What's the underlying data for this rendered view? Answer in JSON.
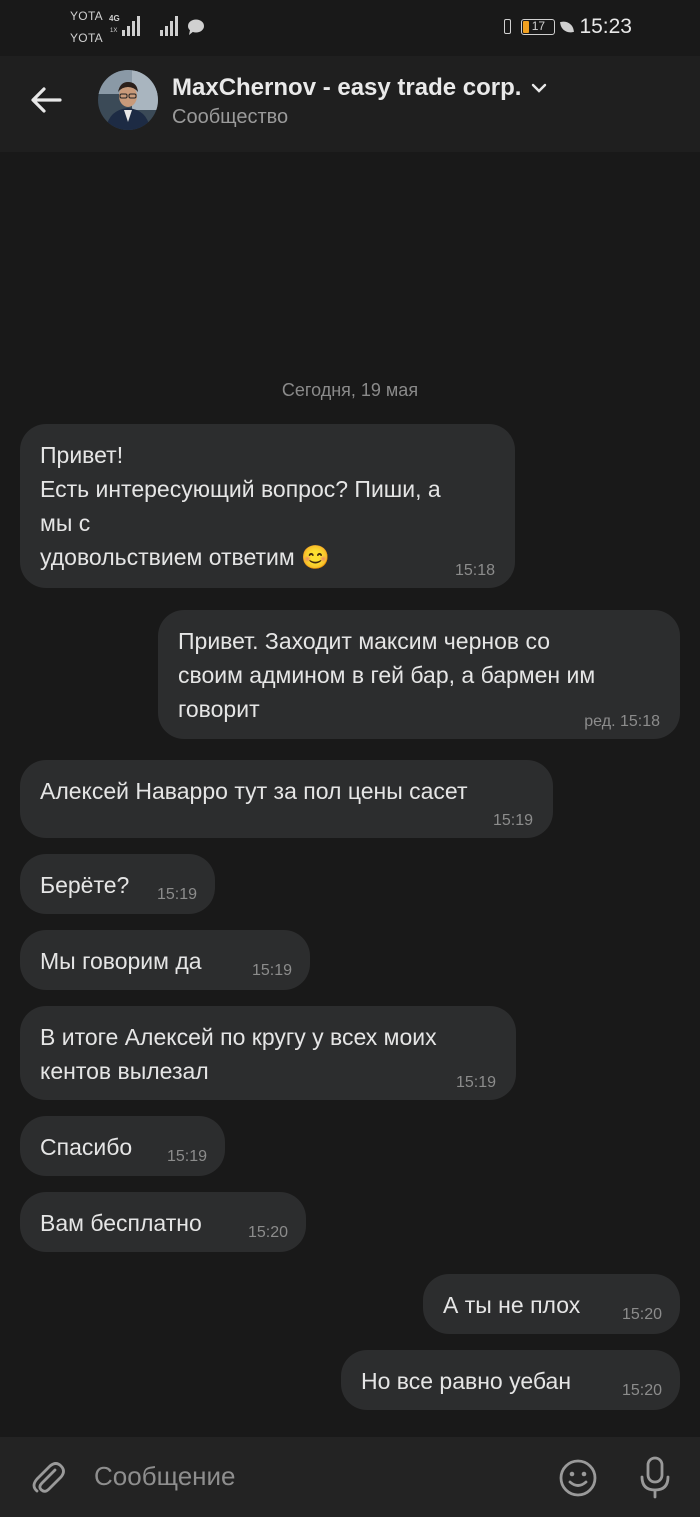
{
  "status_bar": {
    "carrier_top": "YOTA",
    "carrier_bottom": "YOTA",
    "network_type": "4G",
    "secondary_network": "1X",
    "battery_level": "17",
    "time": "15:23"
  },
  "header": {
    "title": "MaxChernov - easy trade corp.",
    "subtitle": "Сообщество",
    "back_icon": "arrow-left-icon",
    "dropdown_icon": "chevron-down-icon"
  },
  "chat": {
    "date_separator": "Сегодня, 19 мая",
    "messages": [
      {
        "side": "in",
        "text": "Привет!\nЕсть интересующий вопрос? Пиши, а\nмы с\nудовольствием ответим 😊",
        "time": "15:18"
      },
      {
        "side": "out",
        "text": "Привет. Заходит максим чернов со\nсвоим админом в гей бар, а бармен им\nговорит",
        "time": "ред. 15:18"
      },
      {
        "side": "in",
        "text": "Алексей Наварро тут за пол цены сасет",
        "time": "15:19"
      },
      {
        "side": "in",
        "text": "Берёте?",
        "time": "15:19"
      },
      {
        "side": "in",
        "text": "Мы говорим да",
        "time": "15:19"
      },
      {
        "side": "in",
        "text": "В итоге Алексей по кругу у всех моих\nкентов вылезал",
        "time": "15:19"
      },
      {
        "side": "in",
        "text": "Спасибо",
        "time": "15:19"
      },
      {
        "side": "in",
        "text": "Вам бесплатно",
        "time": "15:20"
      },
      {
        "side": "out",
        "text": "А ты не плох",
        "time": "15:20"
      },
      {
        "side": "out",
        "text": "Но все равно уебан",
        "time": "15:20"
      }
    ]
  },
  "composer": {
    "placeholder": "Сообщение",
    "attach_icon": "paperclip-icon",
    "emoji_icon": "smiley-icon",
    "mic_icon": "microphone-icon"
  },
  "colors": {
    "background": "#191919",
    "bubble": "#2c2d2e",
    "header": "#1f1f1f",
    "composer": "#232323"
  }
}
